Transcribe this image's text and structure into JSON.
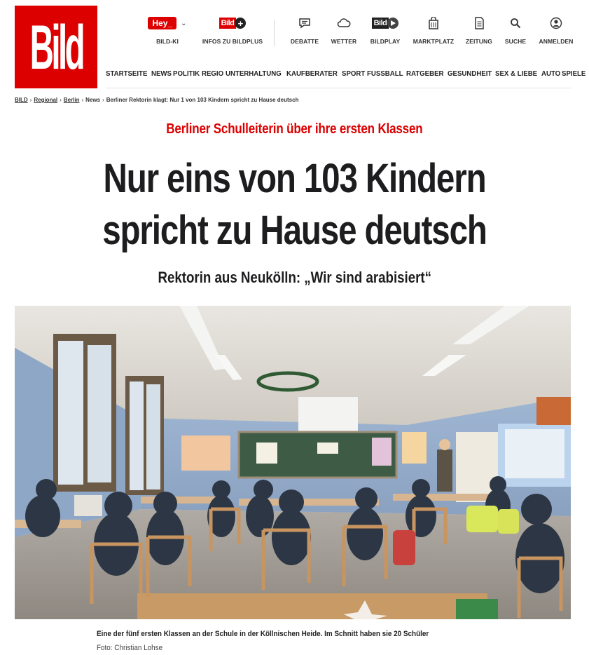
{
  "brand": {
    "logo_text": "Bild",
    "color": "#dd0000"
  },
  "topnav": {
    "items": [
      {
        "label": "BILD-KI",
        "icon": "hey-badge-icon",
        "badge": "Hey"
      },
      {
        "label": "INFOS ZU BILDPLUS",
        "icon": "bildplus-icon",
        "badge": "Bild"
      },
      {
        "label": "DEBATTE",
        "icon": "speech-bubble-icon"
      },
      {
        "label": "WETTER",
        "icon": "cloud-icon"
      },
      {
        "label": "BILDPLAY",
        "icon": "bildplay-icon",
        "badge": "Bild"
      },
      {
        "label": "MARKTPLATZ",
        "icon": "shopping-bag-icon"
      },
      {
        "label": "ZEITUNG",
        "icon": "newspaper-icon"
      },
      {
        "label": "SUCHE",
        "icon": "search-icon"
      },
      {
        "label": "ANMELDEN",
        "icon": "user-icon"
      }
    ]
  },
  "mainnav": [
    "STARTSEITE",
    "NEWS",
    "POLITIK",
    "REGIO",
    "UNTERHALTUNG",
    "KAUFBERATER",
    "SPORT",
    "FUSSBALL",
    "RATGEBER",
    "GESUNDHEIT",
    "SEX & LIEBE",
    "AUTO",
    "SPIELE"
  ],
  "breadcrumb": {
    "items": [
      "BILD",
      "Regional",
      "Berlin",
      "News",
      "Berliner Rektorin klagt: Nur 1 von 103 Kindern spricht zu Hause deutsch"
    ],
    "separator": "›"
  },
  "article": {
    "kicker": "Berliner Schulleiterin über ihre ersten Klassen",
    "headline_line1": "Nur eins von 103 Kindern",
    "headline_line2": "spricht zu Hause deutsch",
    "subheadline": "Rektorin aus Neukölln: „Wir sind arabisiert“",
    "caption": "Eine der fünf ersten Klassen an der Schule in der Köllnischen Heide. Im Schnitt haben sie 20 Schüler",
    "credit": "Foto: Christian Lohse"
  },
  "colors": {
    "accent": "#dd0000",
    "text": "#1d1d1f"
  }
}
